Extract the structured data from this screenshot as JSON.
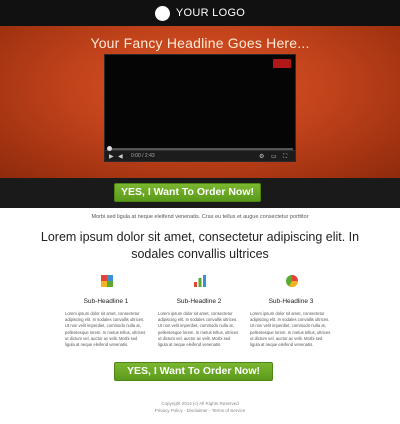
{
  "header": {
    "logo_text": "YOUR LOGO"
  },
  "hero": {
    "headline": "Your Fancy Headline Goes Here..."
  },
  "video": {
    "time": "0:00 / 2:43"
  },
  "cta": {
    "label": "YES, I Want To Order Now!"
  },
  "tagline": "Morbi sed ligula at neque eleifend venenatis. Cras eu tellus et augue consectetur porttitor",
  "main_heading": "Lorem ipsum dolor sit amet, consectetur adipiscing elit. In sodales convallis ultrices",
  "features": [
    {
      "title": "Sub-Headline 1",
      "icon": "blocks-icon",
      "body": "Lorem ipsum dolor sit amet, consectetur adipiscing elit. In sodales convallis ultrices. Ut non velit imperdiet, commodo nulla at, pellentesque lorem. In metus tellus, ultrices ut dictum vel, auctor ac velit. Morbi sed ligula at neque eleifend venenatis."
    },
    {
      "title": "Sub-Headline 2",
      "icon": "bar-chart-icon",
      "body": "Lorem ipsum dolor sit amet, consectetur adipiscing elit. In sodales convallis ultrices. Ut non velit imperdiet, commodo nulla at, pellentesque lorem. In metus tellus, ultrices ut dictum vel, auctor ac velit. Morbi sed ligula at neque eleifend venenatis."
    },
    {
      "title": "Sub-Headline 3",
      "icon": "pie-chart-icon",
      "body": "Lorem ipsum dolor sit amet, consectetur adipiscing elit. In sodales convallis ultrices. Ut non velit imperdiet, commodo nulla at, pellentesque lorem. In metus tellus, ultrices ut dictum vel, auctor ac velit. Morbi sed ligula at neque eleifend venenatis."
    }
  ],
  "footer": {
    "copyright": "Copyright 2014 (c) All Rights Reserved",
    "links": "Privacy Policy - Disclaimer - Terms of Service"
  },
  "colors": {
    "hero": "#c2431b",
    "cta": "#6aa824",
    "bar": "#111111"
  }
}
